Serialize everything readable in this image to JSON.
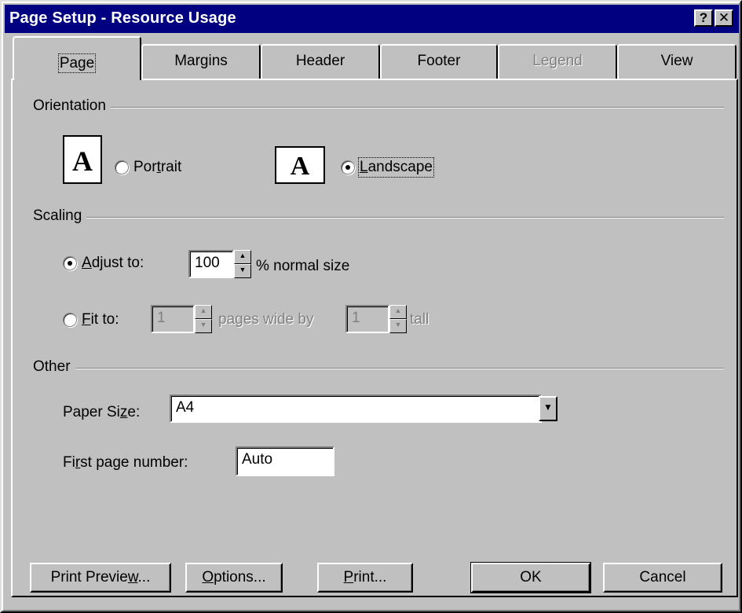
{
  "window": {
    "title": "Page Setup - Resource Usage",
    "help_glyph": "?",
    "close_glyph": "✕"
  },
  "tabs": [
    {
      "label": "Page",
      "active": true,
      "enabled": true
    },
    {
      "label": "Margins",
      "active": false,
      "enabled": true
    },
    {
      "label": "Header",
      "active": false,
      "enabled": true
    },
    {
      "label": "Footer",
      "active": false,
      "enabled": true
    },
    {
      "label": "Legend",
      "active": false,
      "enabled": false
    },
    {
      "label": "View",
      "active": false,
      "enabled": true
    }
  ],
  "orientation": {
    "group_label": "Orientation",
    "icon_letter": "A",
    "portrait": {
      "label_pre": "Por",
      "label_accel": "t",
      "label_post": "rait",
      "selected": false
    },
    "landscape": {
      "label_pre": "",
      "label_accel": "L",
      "label_post": "andscape",
      "selected": true
    }
  },
  "scaling": {
    "group_label": "Scaling",
    "adjust": {
      "label_pre": "",
      "label_accel": "A",
      "label_post": "djust to:",
      "selected": true,
      "value": "100",
      "suffix": "% normal size"
    },
    "fit": {
      "label_pre": "",
      "label_accel": "F",
      "label_post": "it to:",
      "selected": false,
      "wide_value": "1",
      "middle": "pages wide by",
      "tall_value": "1",
      "suffix": "tall"
    }
  },
  "other": {
    "group_label": "Other",
    "paper_size": {
      "label_pre": "Paper Si",
      "label_accel": "z",
      "label_post": "e:",
      "value": "A4"
    },
    "first_page": {
      "label_pre": "Fi",
      "label_accel": "r",
      "label_post": "st page number:",
      "value": "Auto"
    }
  },
  "buttons": {
    "print_preview": {
      "pre": "Print Previe",
      "accel": "w",
      "post": "..."
    },
    "options": {
      "pre": "",
      "accel": "O",
      "post": "ptions..."
    },
    "print": {
      "pre": "",
      "accel": "P",
      "post": "rint..."
    },
    "ok": "OK",
    "cancel": "Cancel"
  }
}
